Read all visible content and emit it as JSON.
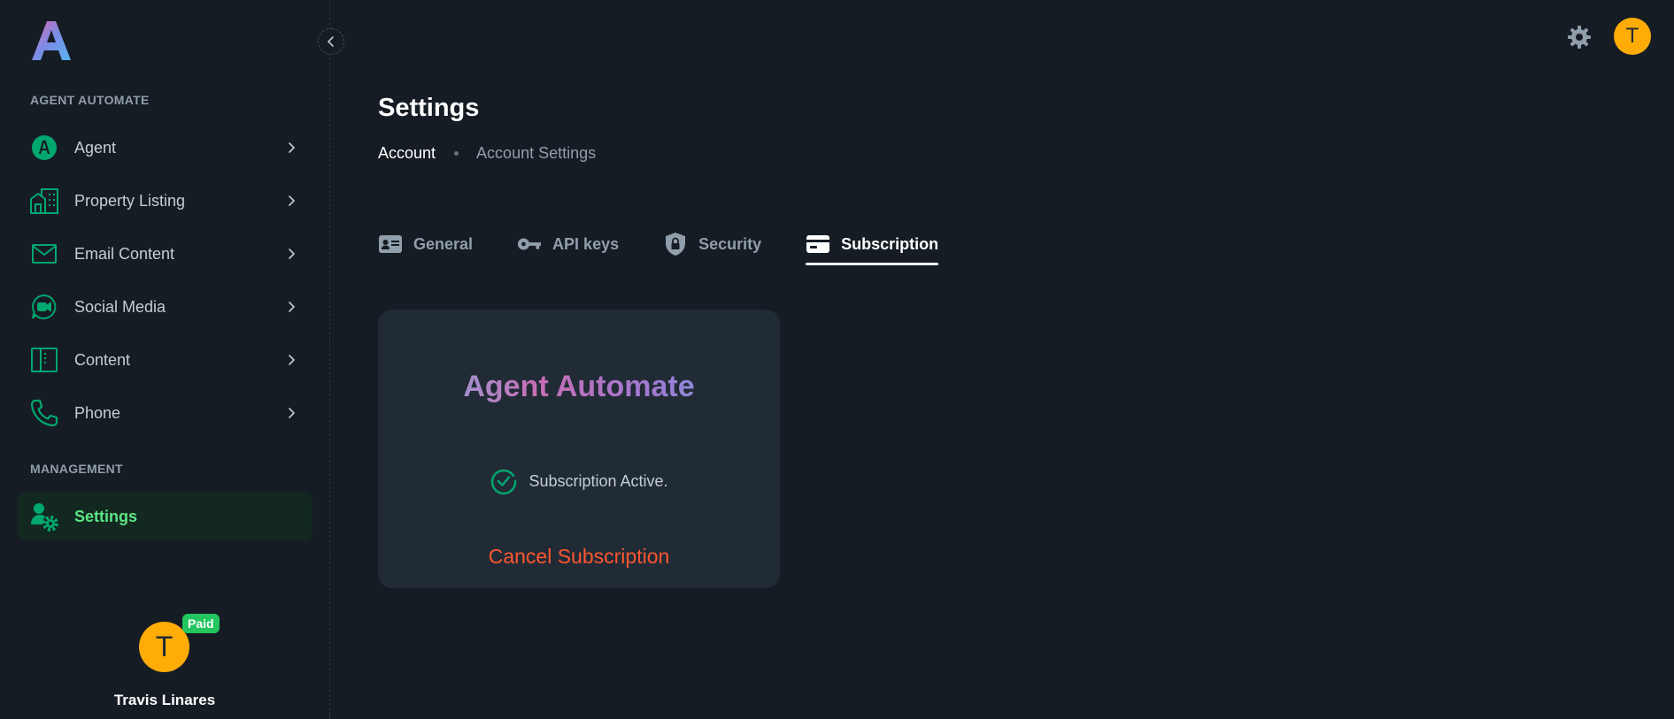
{
  "app": {
    "logo_text": "A"
  },
  "sidebar": {
    "section_agent": "AGENT AUTOMATE",
    "items": [
      {
        "label": "Agent",
        "icon": "agent-badge-icon"
      },
      {
        "label": "Property Listing",
        "icon": "building-icon"
      },
      {
        "label": "Email Content",
        "icon": "mail-icon"
      },
      {
        "label": "Social Media",
        "icon": "video-chat-icon"
      },
      {
        "label": "Content",
        "icon": "book-icon"
      },
      {
        "label": "Phone",
        "icon": "phone-icon"
      }
    ],
    "section_management": "MANAGEMENT",
    "settings_item": {
      "label": "Settings",
      "icon": "user-gear-icon"
    },
    "user": {
      "initial": "T",
      "badge": "Paid",
      "name": "Travis Linares"
    }
  },
  "header": {
    "avatar_initial": "T"
  },
  "page": {
    "title": "Settings",
    "breadcrumb": {
      "link": "Account",
      "current": "Account Settings"
    },
    "tabs": [
      {
        "label": "General",
        "icon": "id-card-icon"
      },
      {
        "label": "API keys",
        "icon": "key-icon"
      },
      {
        "label": "Security",
        "icon": "shield-lock-icon"
      },
      {
        "label": "Subscription",
        "icon": "credit-card-icon"
      }
    ],
    "active_tab": "Subscription"
  },
  "subscription_card": {
    "brand": "Agent Automate",
    "status": "Subscription Active.",
    "cancel_label": "Cancel Subscription"
  },
  "colors": {
    "background": "#161c24",
    "card": "#212b36",
    "primary": "#00a76f",
    "active_text": "#5be584",
    "danger": "#ff5630",
    "avatar": "#ffac07",
    "paid_badge": "#22c55e"
  }
}
